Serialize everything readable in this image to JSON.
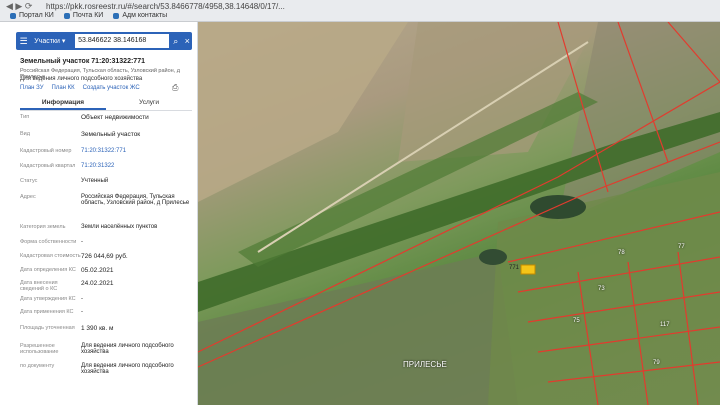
{
  "browser": {
    "url": "https://pkk.rosreestr.ru/#/search/53.8466778/4958,38.14648/0/17/...",
    "bookmarks": [
      "Портал КИ",
      "Почта КИ",
      "Адм контакты"
    ]
  },
  "search": {
    "category": "Участки",
    "value": "53.846622 38.146168"
  },
  "object": {
    "title": "Земельный участок 71:20:31322:771",
    "address_short": "Российская Федерация, Тульская область, Узловский район, д Прилесье",
    "purpose": "Для ведения личного подсобного хозяйства"
  },
  "links": [
    "План ЗУ",
    "План КК",
    "Создать участок ЖС"
  ],
  "tabs": [
    {
      "label": "Информация",
      "active": true
    },
    {
      "label": "Услуги",
      "active": false
    }
  ],
  "rows": [
    {
      "key": "Тип",
      "value": "Объект недвижимости"
    },
    {
      "key": "Вид",
      "value": "Земельный участок"
    },
    {
      "key": "Кадастровый номер",
      "value": "71:20:31322:771",
      "link": true
    },
    {
      "key": "Кадастровый квартал",
      "value": "71:20:31322",
      "link": true
    },
    {
      "key": "Статус",
      "value": "Учтенный"
    },
    {
      "key": "Адрес",
      "value": "Российская Федерация, Тульская область, Узловский район, д Прилесье"
    },
    {
      "key": "Категория земель",
      "value": "Земли населённых пунктов"
    },
    {
      "key": "Форма собственности",
      "value": "-"
    },
    {
      "key": "Кадастровая стоимость",
      "value": "726 044,69 руб."
    },
    {
      "key": "Дата определения КС",
      "value": "05.02.2021"
    },
    {
      "key": "Дата внесения сведений о КС",
      "value": "24.02.2021"
    },
    {
      "key": "Дата утверждения КС",
      "value": "-"
    },
    {
      "key": "Дата применения КС",
      "value": "-"
    },
    {
      "key": "Площадь уточненная",
      "value": "1 390 кв. м"
    },
    {
      "key": "Разрешенное использование",
      "value": "Для ведения личного подсобного хозяйства"
    },
    {
      "key": "по документу",
      "value": "Для ведения личного подсобного хозяйства"
    }
  ],
  "map": {
    "village_label": "ПРИЛЕСЬЕ",
    "parcel_labels": [
      "771",
      "73",
      "75",
      "117",
      "79",
      "77",
      "78"
    ],
    "colors": {
      "boundary": "#e23b2e",
      "selected": "#f5c518"
    }
  }
}
